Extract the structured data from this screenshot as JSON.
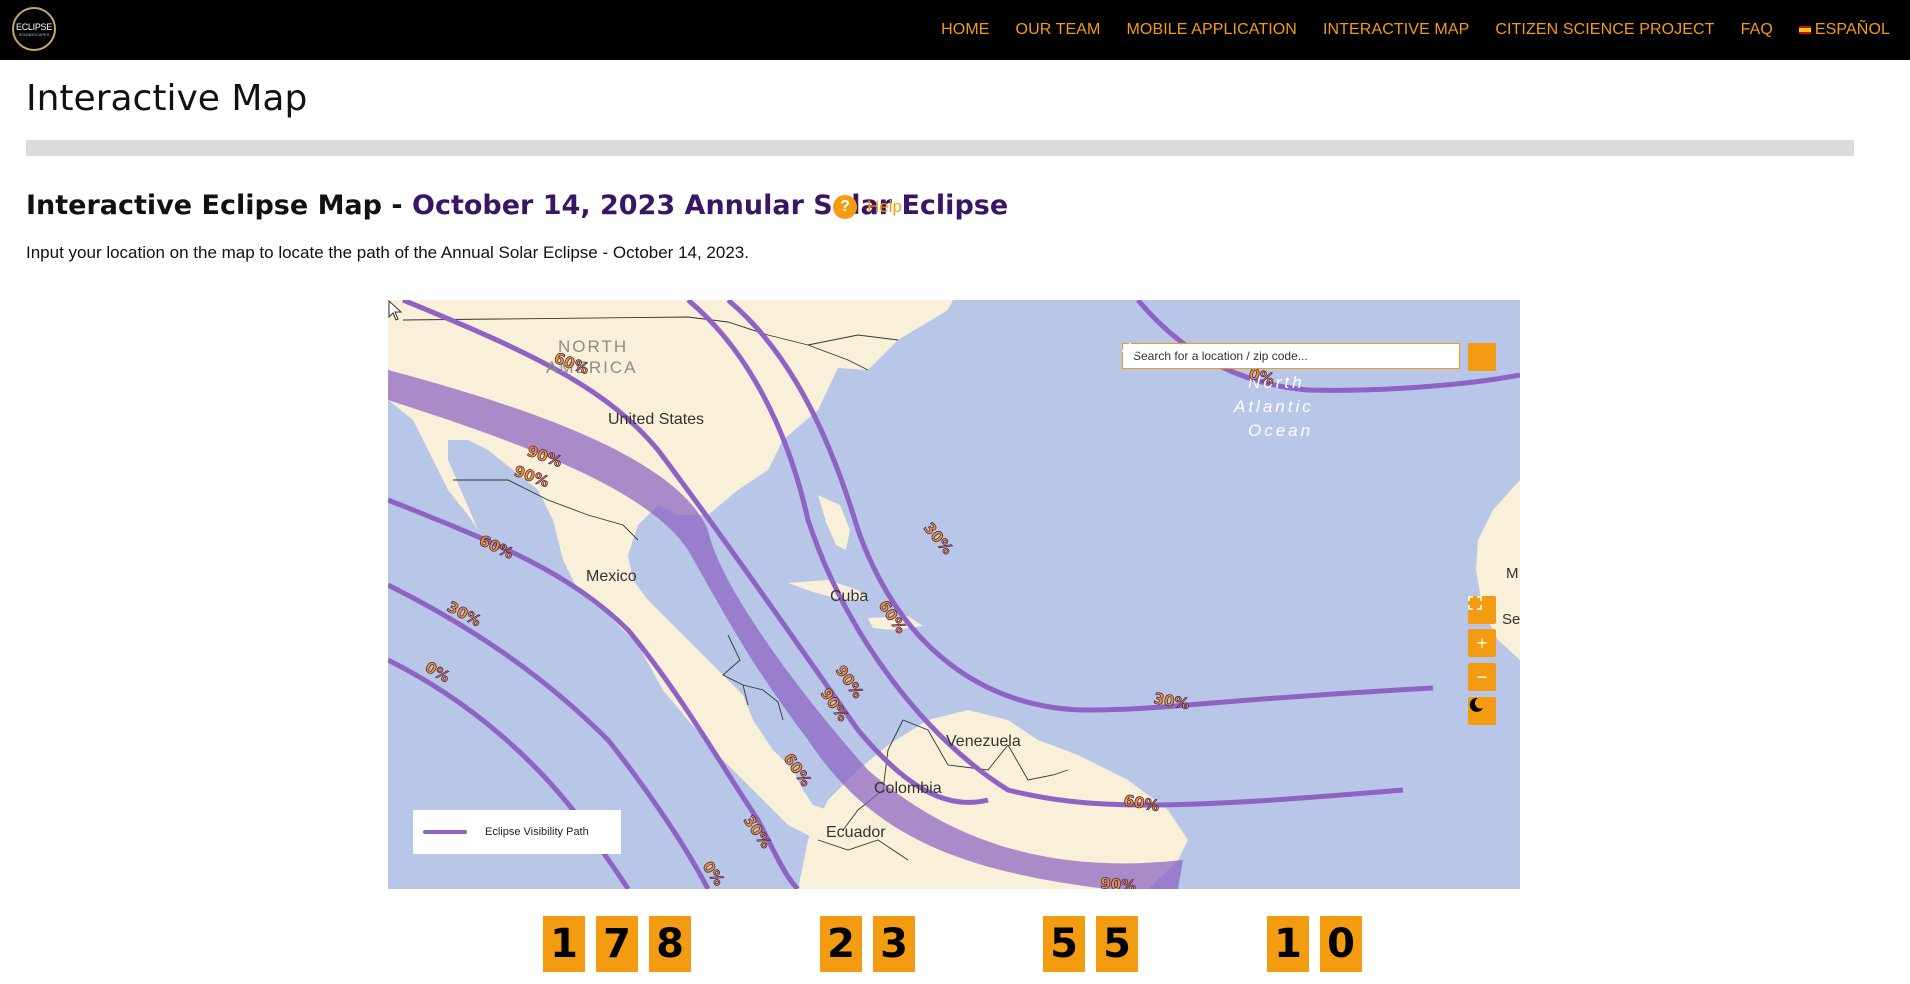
{
  "nav": {
    "logo_line1": "ECLIPSE",
    "logo_line2": "SOUNDSCAPES",
    "items": [
      {
        "label": "HOME"
      },
      {
        "label": "OUR TEAM"
      },
      {
        "label": "MOBILE APPLICATION"
      },
      {
        "label": "INTERACTIVE MAP"
      },
      {
        "label": "CITIZEN SCIENCE PROJECT"
      },
      {
        "label": "FAQ"
      },
      {
        "label": "ESPAÑOL"
      }
    ]
  },
  "page": {
    "title": "Interactive Map",
    "section_title_prefix": "Interactive Eclipse Map - ",
    "section_title_highlight": "October 14, 2023 Annular Solar Eclipse",
    "help_label": "Help",
    "description": "Input your location on the map to locate the path of the Annual Solar Eclipse - October 14, 2023."
  },
  "map": {
    "search_placeholder": "Search for a location / zip code...",
    "labels": {
      "north_america_1": "NORTH",
      "north_america_2": "AMERICA",
      "united_states": "United States",
      "mexico": "Mexico",
      "cuba": "Cuba",
      "venezuela": "Venezuela",
      "colombia": "Colombia",
      "ecuador": "Ecuador",
      "ocean_1": "North",
      "ocean_2": "Atlantic",
      "ocean_3": "Ocean",
      "senegal": "Seneg",
      "mali": "M"
    },
    "percent_labels": [
      "60%",
      "90%",
      "90%",
      "60%",
      "30%",
      "0%",
      "30%",
      "60%",
      "90%",
      "90%",
      "60%",
      "30%",
      "0%",
      "30%",
      "60%",
      "0%",
      "90%"
    ],
    "legend_label": "Eclipse Visibility Path",
    "controls": {
      "zoom_in": "+",
      "zoom_out": "−"
    },
    "colors": {
      "ocean": "#b8c6e8",
      "land": "#f8f0d8",
      "path": "#8e63c4",
      "accent": "#f39c12"
    }
  },
  "countdown": {
    "groups": [
      {
        "digits": [
          "1",
          "7",
          "8"
        ]
      },
      {
        "digits": [
          "2",
          "3"
        ]
      },
      {
        "digits": [
          "5",
          "5"
        ]
      },
      {
        "digits": [
          "1",
          "0"
        ]
      }
    ]
  }
}
